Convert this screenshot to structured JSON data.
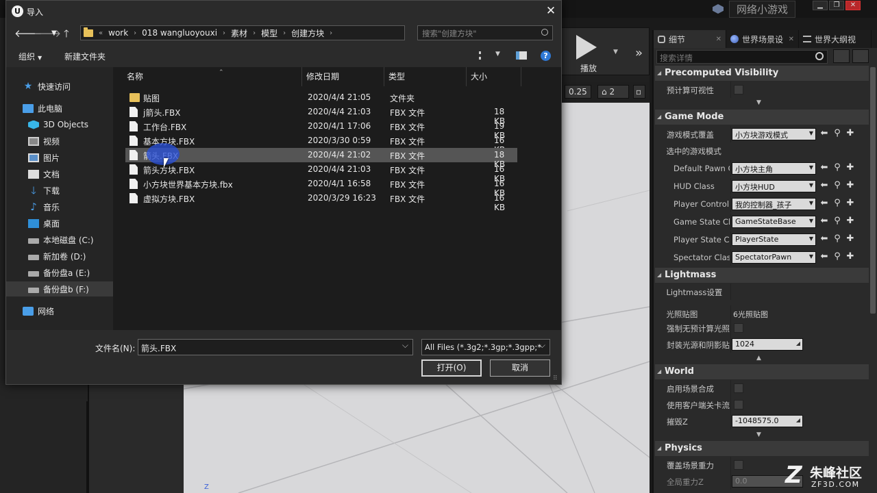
{
  "editor": {
    "project_title": "网络小游戏",
    "play_label": "播放",
    "viewport_controls": {
      "snap_value": "0.25",
      "camera_speed": "2"
    },
    "axis_label": "Z"
  },
  "details": {
    "tabs": [
      {
        "label": "细节",
        "icon": "gear-icon"
      },
      {
        "label": "世界场景设",
        "icon": "globe-icon"
      },
      {
        "label": "世界大纲视",
        "icon": "list-icon"
      }
    ],
    "search_placeholder": "搜索详情",
    "sections": {
      "precomputed": {
        "title": "Precomputed Visibility",
        "prop": "预计算可视性"
      },
      "game_mode": {
        "title": "Game Mode",
        "override_label": "游戏模式覆盖",
        "override_value": "小方块游戏模式",
        "selected_label": "选中的游戏模式",
        "rows": [
          {
            "label": "Default Pawn Cl",
            "value": "小方块主角"
          },
          {
            "label": "HUD Class",
            "value": "小方块HUD"
          },
          {
            "label": "Player Controlle",
            "value": "我的控制器_孩子"
          },
          {
            "label": "Game State Cla",
            "value": "GameStateBase"
          },
          {
            "label": "Player State Cla",
            "value": "PlayerState"
          },
          {
            "label": "Spectator Class",
            "value": "SpectatorPawn"
          }
        ]
      },
      "lightmass": {
        "title": "Lightmass",
        "settings_label": "Lightmass设置",
        "lightmap_label": "光照贴图",
        "lightmap_value": "6光照贴图",
        "force_no_precomp_label": "强制无预计算光照",
        "packed_label": "封装光源和阴影贴",
        "packed_value": "1024"
      },
      "world": {
        "title": "World",
        "scene_composition_label": "启用场景合成",
        "client_level_label": "使用客户端关卡流",
        "kill_z_label": "摧毁Z",
        "kill_z_value": "-1048575.0"
      },
      "physics": {
        "title": "Physics",
        "override_gravity_label": "覆盖场景重力",
        "global_gravity_label": "全局重力Z",
        "global_gravity_value": "0.0"
      }
    }
  },
  "watermark": {
    "logo": "Z",
    "name": "朱峰社区",
    "url": "ZF3D.COM"
  },
  "dialog": {
    "title": "导入",
    "address": {
      "overflow": "«",
      "segments": [
        "work",
        "018 wangluoyouxi",
        "素材",
        "模型",
        "创建方块"
      ]
    },
    "search_placeholder": "搜索\"创建方块\"",
    "commands": {
      "organize": "组织",
      "new_folder": "新建文件夹"
    },
    "nav_items": [
      {
        "label": "快速访问",
        "icon": "star-icon",
        "indent": 1
      },
      {
        "label": "此电脑",
        "icon": "pc-icon",
        "indent": 1
      },
      {
        "label": "3D Objects",
        "icon": "cube-icon",
        "indent": 2
      },
      {
        "label": "视频",
        "icon": "video-icon",
        "indent": 2
      },
      {
        "label": "图片",
        "icon": "picture-icon",
        "indent": 2
      },
      {
        "label": "文档",
        "icon": "document-icon",
        "indent": 2
      },
      {
        "label": "下载",
        "icon": "download-icon",
        "indent": 2
      },
      {
        "label": "音乐",
        "icon": "music-icon",
        "indent": 2
      },
      {
        "label": "桌面",
        "icon": "desktop-icon",
        "indent": 2
      },
      {
        "label": "本地磁盘 (C:)",
        "icon": "drive-icon",
        "indent": 2
      },
      {
        "label": "新加卷 (D:)",
        "icon": "drive-icon",
        "indent": 2
      },
      {
        "label": "备份盘a (E:)",
        "icon": "drive-icon",
        "indent": 2
      },
      {
        "label": "备份盘b (F:)",
        "icon": "drive-icon",
        "indent": 2,
        "selected": true
      },
      {
        "label": "网络",
        "icon": "network-icon",
        "indent": 1
      }
    ],
    "columns": {
      "name": "名称",
      "modified": "修改日期",
      "type": "类型",
      "size": "大小"
    },
    "files": [
      {
        "name": "贴图",
        "date": "2020/4/4 21:05",
        "type": "文件夹",
        "size": "",
        "folder": true
      },
      {
        "name": "j箭头.FBX",
        "date": "2020/4/4 21:03",
        "type": "FBX 文件",
        "size": "18 KB"
      },
      {
        "name": "工作台.FBX",
        "date": "2020/4/1 17:06",
        "type": "FBX 文件",
        "size": "19 KB"
      },
      {
        "name": "基本方块.FBX",
        "date": "2020/3/30 0:59",
        "type": "FBX 文件",
        "size": "16 KB"
      },
      {
        "name": "箭头.FBX",
        "date": "2020/4/4 21:02",
        "type": "FBX 文件",
        "size": "18 KB",
        "selected": true
      },
      {
        "name": "箭头方块.FBX",
        "date": "2020/4/4 21:03",
        "type": "FBX 文件",
        "size": "16 KB"
      },
      {
        "name": "小方块世界基本方块.fbx",
        "date": "2020/4/1 16:58",
        "type": "FBX 文件",
        "size": "16 KB"
      },
      {
        "name": "虚拟方块.FBX",
        "date": "2020/3/29 16:23",
        "type": "FBX 文件",
        "size": "16 KB"
      }
    ],
    "filename_label": "文件名(N):",
    "filename_value": "箭头.FBX",
    "filetype_value": "All Files (*.3g2;*.3gp;*.3gpp;*",
    "open_label": "打开(O)",
    "cancel_label": "取消"
  }
}
